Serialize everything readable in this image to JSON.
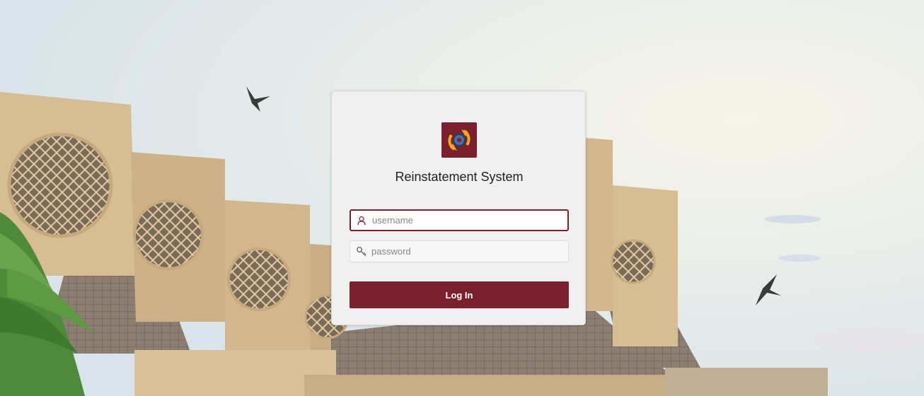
{
  "app": {
    "title": "Reinstatement System",
    "logo_icon": "gear-sync-icon"
  },
  "login": {
    "username_placeholder": "username",
    "password_placeholder": "password",
    "submit_label": "Log In",
    "username_icon": "user-icon",
    "password_icon": "key-icon"
  },
  "colors": {
    "brand": "#7a1f2e",
    "card_bg": "#f0f0f0"
  }
}
